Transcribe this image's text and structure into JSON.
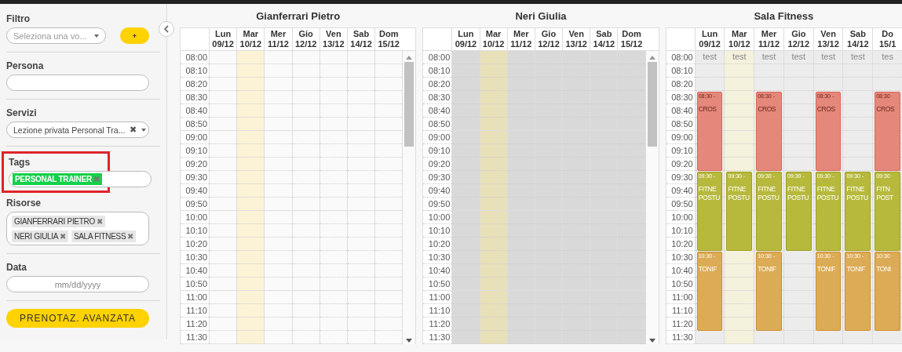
{
  "sidebar": {
    "filter": {
      "label": "Filtro",
      "placeholder": "Seleziona una vo...",
      "add_button": "+"
    },
    "person": {
      "label": "Persona"
    },
    "services": {
      "label": "Servizi",
      "value": "Lezione privata Personal Tra...",
      "clear": "✖"
    },
    "tags": {
      "label": "Tags",
      "highlighted": true,
      "chips": [
        {
          "text": "PERSONAL TRAINER",
          "remove": "✖"
        }
      ]
    },
    "resources": {
      "label": "Risorse",
      "chips": [
        {
          "text": "GIANFERRARI PIETRO",
          "remove": "✖"
        },
        {
          "text": "NERI GIULIA",
          "remove": "✖"
        },
        {
          "text": "SALA FITNESS",
          "remove": "✖"
        }
      ]
    },
    "date": {
      "label": "Data",
      "placeholder": "mm/dd/yyyy"
    },
    "advanced_button": "PRENOTAZ. AVANZATA"
  },
  "calendars": [
    {
      "title": "Gianferrari Pietro",
      "kind": "empty",
      "days": [
        {
          "name": "Lun",
          "date": "09/12",
          "today": false
        },
        {
          "name": "Mar",
          "date": "10/12",
          "today": true
        },
        {
          "name": "Mer",
          "date": "11/12",
          "today": false
        },
        {
          "name": "Gio",
          "date": "12/12",
          "today": false
        },
        {
          "name": "Ven",
          "date": "13/12",
          "today": false
        },
        {
          "name": "Sab",
          "date": "14/12",
          "today": false
        },
        {
          "name": "Dom",
          "date": "15/12",
          "today": false
        }
      ],
      "times": [
        "08:00",
        "08:10",
        "08:20",
        "08:30",
        "08:40",
        "08:50",
        "09:00",
        "09:10",
        "09:20",
        "09:30",
        "09:40",
        "09:50",
        "10:00",
        "10:10",
        "10:20",
        "10:30",
        "10:40",
        "10:50",
        "11:00",
        "11:10",
        "11:20",
        "11:30"
      ]
    },
    {
      "title": "Neri Giulia",
      "kind": "closed",
      "days": [
        {
          "name": "Lun",
          "date": "09/12",
          "today": false
        },
        {
          "name": "Mar",
          "date": "10/12",
          "today": true
        },
        {
          "name": "Mer",
          "date": "11/12",
          "today": false
        },
        {
          "name": "Gio",
          "date": "12/12",
          "today": false
        },
        {
          "name": "Ven",
          "date": "13/12",
          "today": false
        },
        {
          "name": "Sab",
          "date": "14/12",
          "today": false
        },
        {
          "name": "Dom",
          "date": "15/12",
          "today": false
        }
      ],
      "times": [
        "08:00",
        "08:10",
        "08:20",
        "08:30",
        "08:40",
        "08:50",
        "09:00",
        "09:10",
        "09:20",
        "09:30",
        "09:40",
        "09:50",
        "10:00",
        "10:10",
        "10:20",
        "10:30",
        "10:40",
        "10:50",
        "11:00",
        "11:10",
        "11:20",
        "11:30"
      ]
    },
    {
      "title": "Sala Fitness",
      "kind": "scheduled",
      "days": [
        {
          "name": "Lun",
          "date": "09/12",
          "today": false,
          "note": "test",
          "events": [
            {
              "kind": "cross",
              "time": "08:30 -",
              "lines": [
                "CROS"
              ]
            },
            {
              "kind": "fitness",
              "time": "09:30 -",
              "lines": [
                "FITNE",
                "POSTU"
              ]
            },
            {
              "kind": "toning",
              "time": "10:30 -",
              "lines": [
                "TONIF"
              ]
            }
          ]
        },
        {
          "name": "Mar",
          "date": "10/12",
          "today": true,
          "note": "test",
          "events": [
            {
              "kind": "fitness",
              "time": "09:30 -",
              "lines": [
                "FITNE",
                "POSTU"
              ]
            }
          ]
        },
        {
          "name": "Mer",
          "date": "11/12",
          "today": false,
          "note": "test",
          "events": [
            {
              "kind": "cross",
              "time": "08:30 -",
              "lines": [
                "CROS"
              ]
            },
            {
              "kind": "fitness",
              "time": "09:30 -",
              "lines": [
                "FITNE",
                "POSTU"
              ]
            },
            {
              "kind": "toning",
              "time": "10:30 -",
              "lines": [
                "TONIF"
              ]
            }
          ]
        },
        {
          "name": "Gio",
          "date": "12/12",
          "today": false,
          "note": "test",
          "events": [
            {
              "kind": "fitness",
              "time": "09:30 -",
              "lines": [
                "FITNE",
                "POSTU"
              ]
            }
          ]
        },
        {
          "name": "Ven",
          "date": "13/12",
          "today": false,
          "note": "test",
          "events": [
            {
              "kind": "cross",
              "time": "08:30 -",
              "lines": [
                "CROS"
              ]
            },
            {
              "kind": "fitness",
              "time": "09:30 -",
              "lines": [
                "FITNE",
                "POSTU"
              ]
            },
            {
              "kind": "toning",
              "time": "10:30 -",
              "lines": [
                "TONIF"
              ]
            }
          ]
        },
        {
          "name": "Sab",
          "date": "14/12",
          "today": false,
          "note": "test",
          "events": [
            {
              "kind": "fitness",
              "time": "09:30 -",
              "lines": [
                "FITNE",
                "POSTU"
              ]
            },
            {
              "kind": "toning",
              "time": "10:30 -",
              "lines": [
                "TONIF"
              ]
            }
          ]
        },
        {
          "name": "Do",
          "date": "15/1",
          "today": false,
          "note": "tes",
          "events": [
            {
              "kind": "cross",
              "time": "08:30",
              "lines": [
                "CROS"
              ]
            },
            {
              "kind": "fitness",
              "time": "09:30",
              "lines": [
                "FITN",
                "POST"
              ]
            },
            {
              "kind": "toning",
              "time": "10:30",
              "lines": [
                "TONI"
              ]
            }
          ]
        }
      ],
      "times": [
        "08:00",
        "08:10",
        "08:20",
        "08:30",
        "08:40",
        "08:50",
        "09:00",
        "09:10",
        "09:20",
        "09:30",
        "09:40",
        "09:50",
        "10:00",
        "10:10",
        "10:20",
        "10:30",
        "10:40",
        "10:50",
        "11:00",
        "11:10",
        "11:20",
        "11:30"
      ]
    }
  ]
}
